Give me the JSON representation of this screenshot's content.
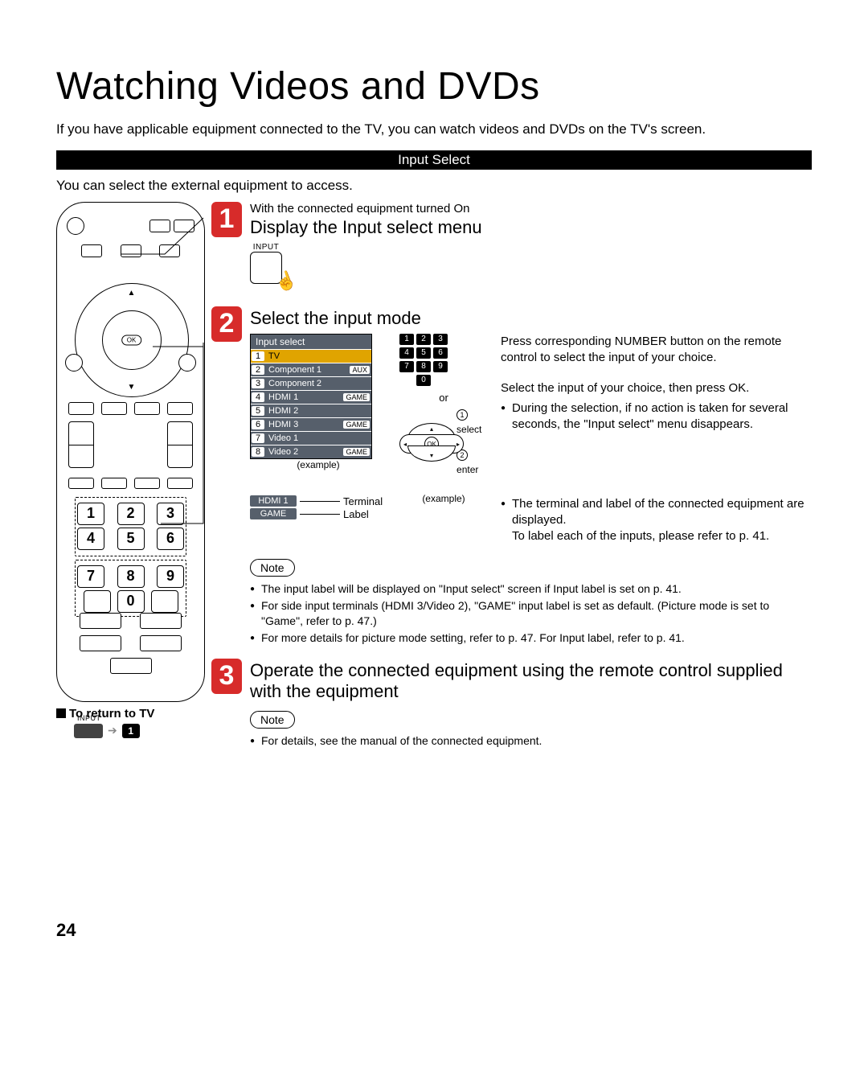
{
  "page_number": "24",
  "title": "Watching Videos and DVDs",
  "intro": "If you have applicable equipment connected to the TV, you can watch videos and DVDs on the TV's screen.",
  "section_bar": "Input Select",
  "sub_intro": "You can select the external equipment to access.",
  "step1": {
    "num": "1",
    "pre": "With the connected equipment turned On",
    "title": "Display the Input select menu",
    "btn_label": "INPUT"
  },
  "step2": {
    "num": "2",
    "title": "Select the input mode",
    "menu_header": "Input select",
    "menu_items": [
      {
        "idx": "1",
        "name": "TV",
        "tag": ""
      },
      {
        "idx": "2",
        "name": "Component 1",
        "tag": "AUX"
      },
      {
        "idx": "3",
        "name": "Component 2",
        "tag": ""
      },
      {
        "idx": "4",
        "name": "HDMI 1",
        "tag": "GAME"
      },
      {
        "idx": "5",
        "name": "HDMI 2",
        "tag": ""
      },
      {
        "idx": "6",
        "name": "HDMI 3",
        "tag": "GAME"
      },
      {
        "idx": "7",
        "name": "Video 1",
        "tag": ""
      },
      {
        "idx": "8",
        "name": "Video 2",
        "tag": "GAME"
      }
    ],
    "example": "(example)",
    "or": "or",
    "sel_label_1": "select",
    "sel_label_2": "enter",
    "num1": "1",
    "num2": "2",
    "term_terminal": "HDMI 1",
    "term_label": "GAME",
    "term_t_text": "Terminal",
    "term_l_text": "Label",
    "right_a": "Press corresponding NUMBER button on the remote control to select the input of your choice.",
    "right_b": "Select the input of your choice, then press OK.",
    "bullet1": "During the selection, if no action is taken for several seconds, the \"Input select\" menu disappears.",
    "bullet2a": "The terminal and label of the connected equipment are displayed.",
    "bullet2b": "To label each of the inputs, please refer to p. 41.",
    "note_label": "Note",
    "notes": [
      "The input label will be displayed on \"Input select\" screen if Input label is set on p. 41.",
      "For side input terminals (HDMI 3/Video 2), \"GAME\" input label is set as default. (Picture mode is set to \"Game\", refer to p. 47.)",
      "For more details for picture mode setting, refer to p. 47. For Input label, refer to p. 41."
    ]
  },
  "step3": {
    "num": "3",
    "title": "Operate the connected equipment using the remote control supplied with the equipment",
    "note_label": "Note",
    "note_text": "For details, see the manual of the connected equipment."
  },
  "return": {
    "heading": "To return to TV",
    "input": "INPUT",
    "num": "1"
  },
  "remote": {
    "ok": "OK",
    "numbers": [
      "1",
      "2",
      "3",
      "4",
      "5",
      "6",
      "7",
      "8",
      "9",
      "0"
    ]
  },
  "numgrid": [
    "1",
    "2",
    "3",
    "4",
    "5",
    "6",
    "7",
    "8",
    "9",
    "0"
  ]
}
